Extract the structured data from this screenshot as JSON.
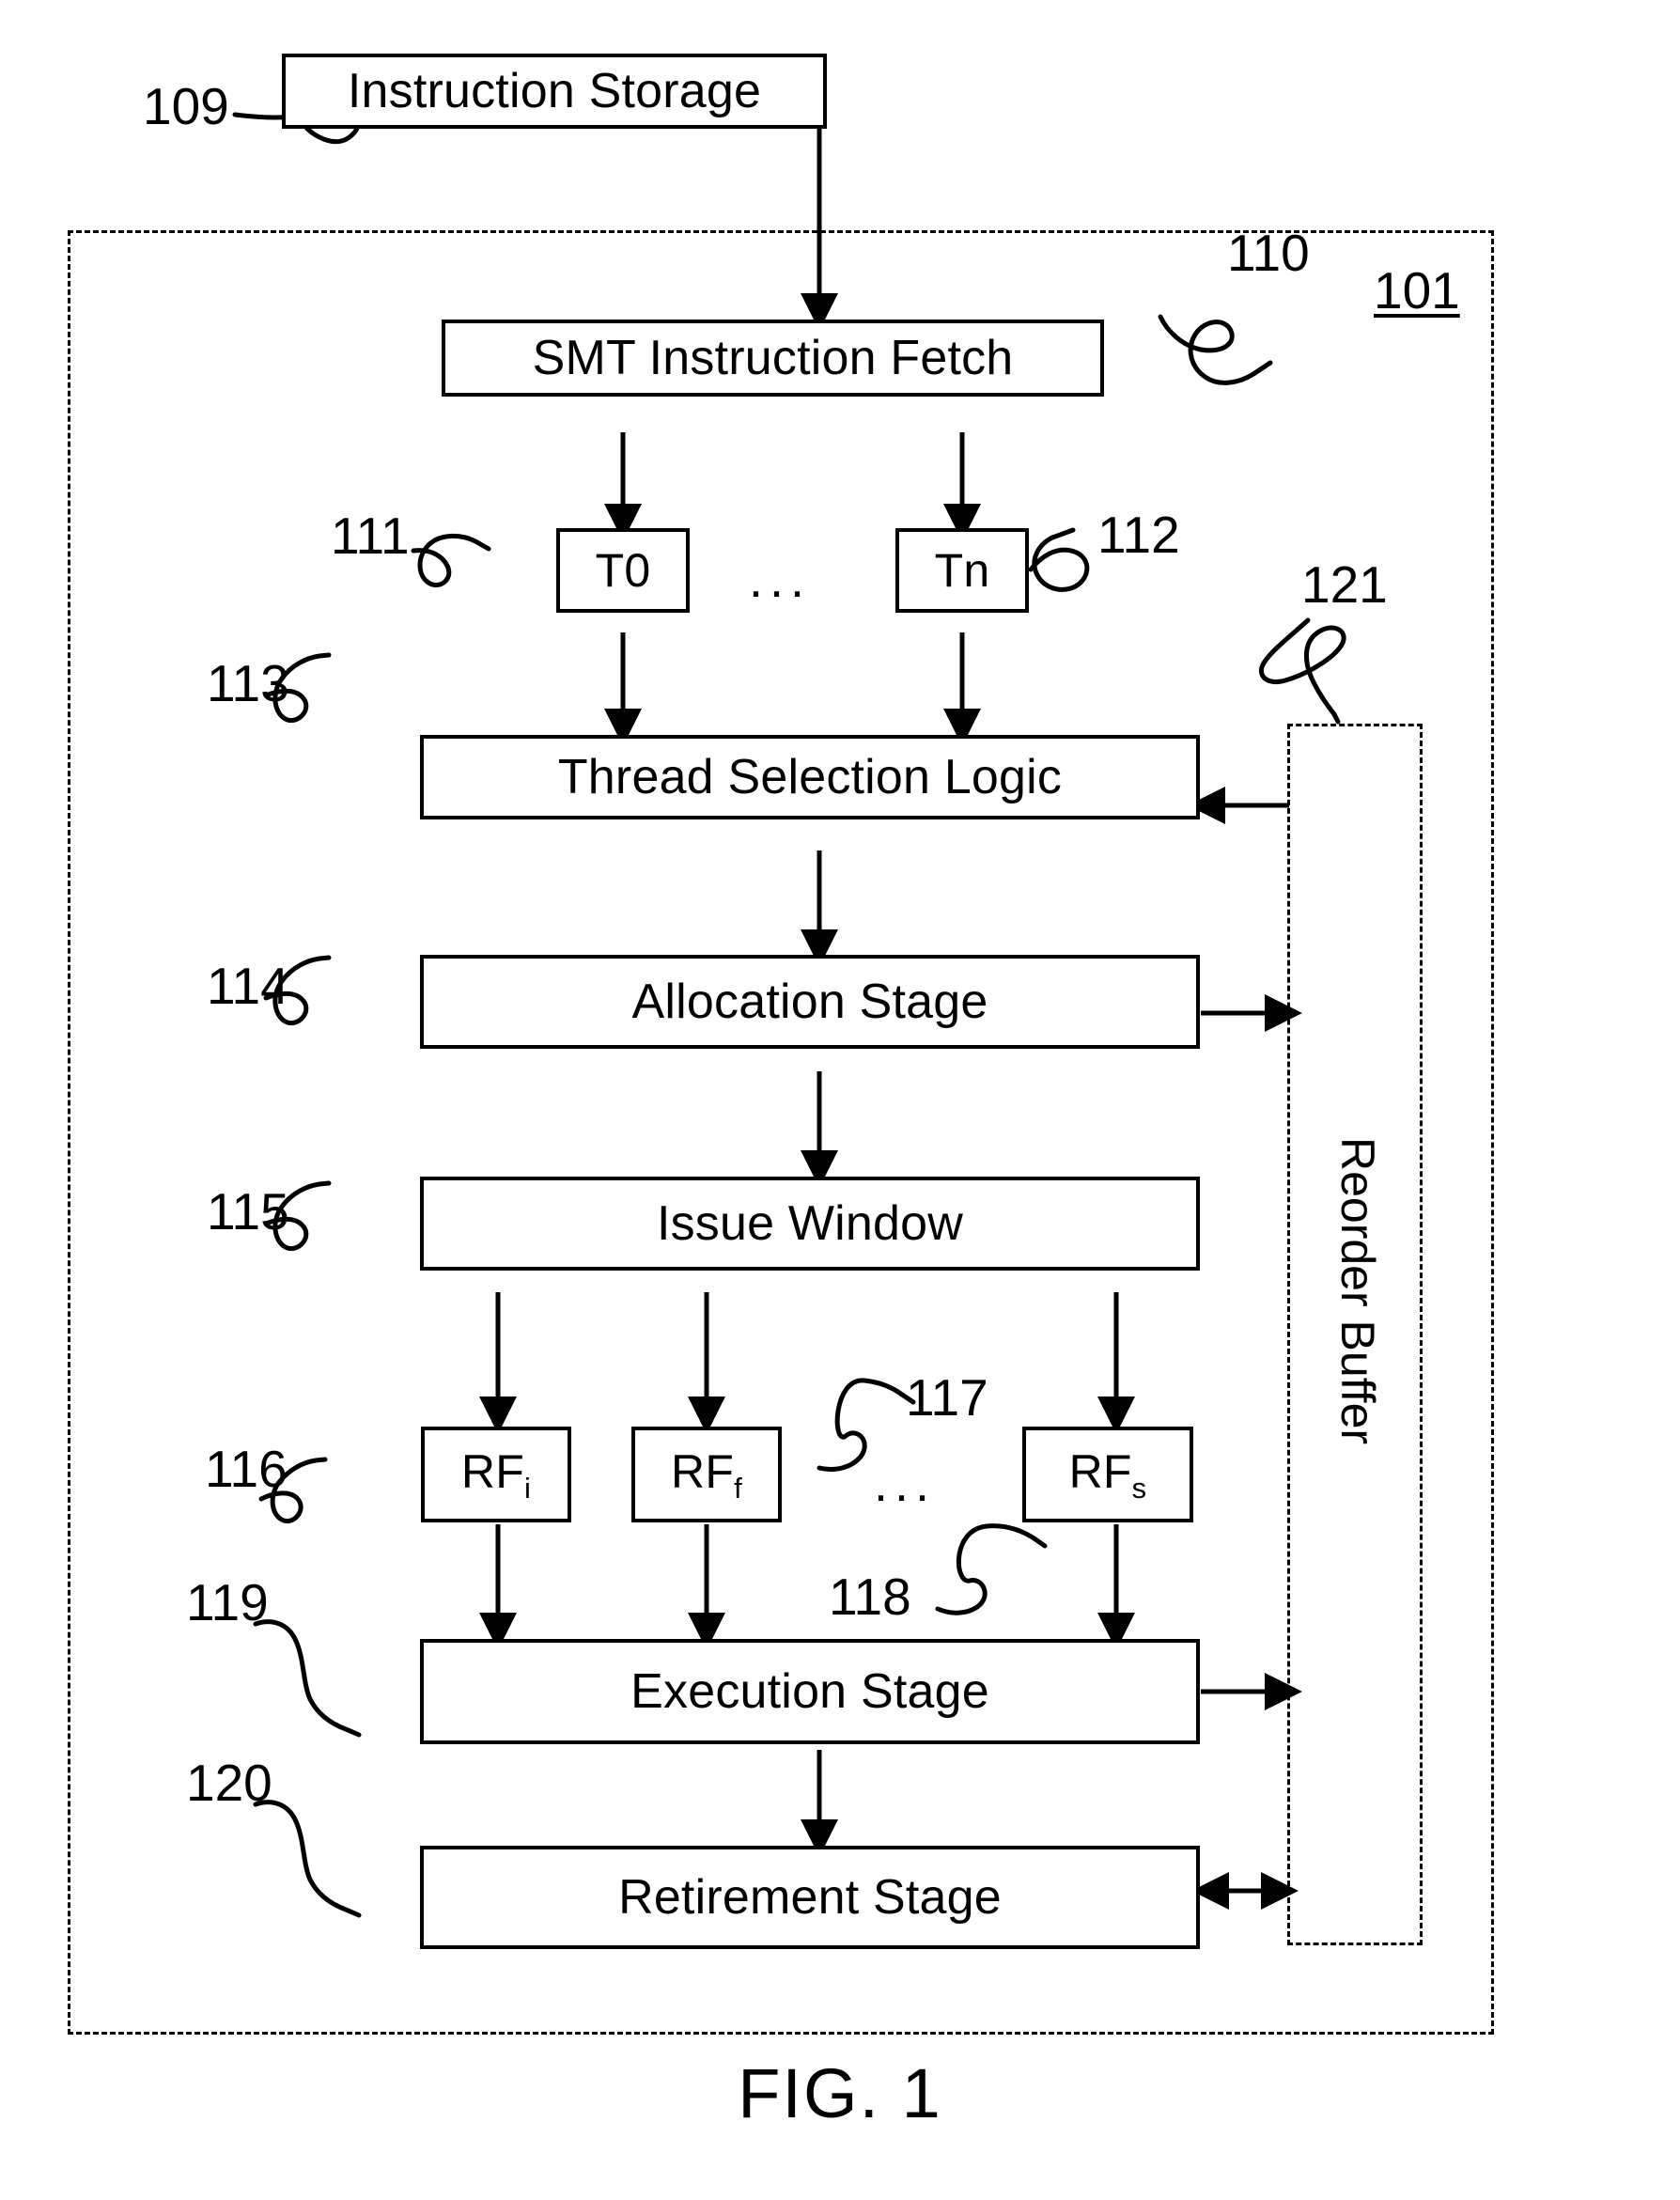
{
  "figure": {
    "caption": "FIG. 1",
    "type": "patent-block-diagram"
  },
  "boxes": {
    "instruction_storage": {
      "label": "Instruction Storage",
      "ref": "109"
    },
    "smt_instruction_fetch": {
      "label": "SMT Instruction Fetch",
      "ref": "110"
    },
    "thread_t0": {
      "label": "T0",
      "ref": "111"
    },
    "thread_tn": {
      "label": "Tn",
      "ref": "112"
    },
    "thread_selection_logic": {
      "label": "Thread Selection Logic",
      "ref": "113"
    },
    "allocation_stage": {
      "label": "Allocation Stage",
      "ref": "114"
    },
    "issue_window": {
      "label": "Issue Window",
      "ref": "115"
    },
    "rf_i": {
      "label": "RF",
      "subscript": "i",
      "ref": "116"
    },
    "rf_f": {
      "label": "RF",
      "subscript": "f",
      "ref": "117"
    },
    "rf_s": {
      "label": "RF",
      "subscript": "s",
      "ref": "118"
    },
    "execution_stage": {
      "label": "Execution Stage",
      "ref": "119"
    },
    "retirement_stage": {
      "label": "Retirement Stage",
      "ref": "120"
    },
    "reorder_buffer": {
      "label": "Reorder Buffer",
      "ref": "121"
    },
    "processor_boundary": {
      "ref": "101"
    }
  },
  "refs": {
    "r109": "109",
    "r110": "110",
    "r111": "111",
    "r112": "112",
    "r113": "113",
    "r114": "114",
    "r115": "115",
    "r116": "116",
    "r117": "117",
    "r118": "118",
    "r119": "119",
    "r120": "120",
    "r121": "121",
    "r101": "101"
  },
  "ellipsis": {
    "threads": "...",
    "register_files": "..."
  },
  "colors": {
    "ink": "#000000",
    "paper": "#ffffff"
  }
}
